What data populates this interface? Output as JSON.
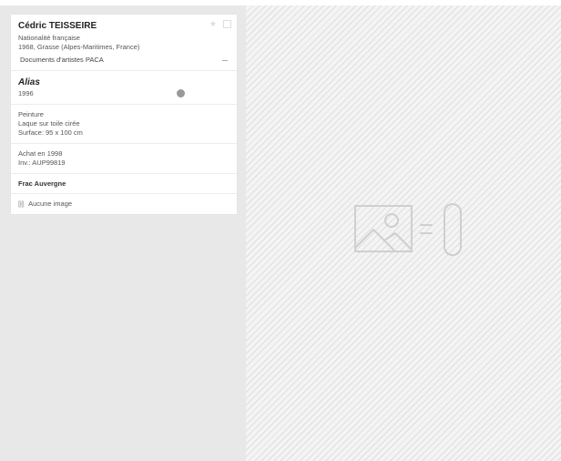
{
  "artist": {
    "name": "Cédric TEISSEIRE",
    "nationality": "Nationalité française",
    "birth": "1968, Grasse (Alpes-Maritimes, France)",
    "docs_label": "Documents d'artistes PACA"
  },
  "work": {
    "title": "Alias",
    "year": "1996"
  },
  "technique": {
    "category": "Peinture",
    "medium": "Laque sur toile cirée",
    "dimensions": "Surface: 95 x 100 cm"
  },
  "acquisition": {
    "purchase": "Achat en 1998",
    "inventory": "Inv.: AUP99819"
  },
  "owner": {
    "name": "Frac Auvergne"
  },
  "images": {
    "icon": "[]-[]",
    "label": "Aucune image"
  },
  "icons": {
    "favorite": "star-icon",
    "select": "square-icon",
    "placeholder": "image-equals-zero-icon"
  },
  "colors": {
    "left_bg": "#e8e8e8",
    "card_bg": "#ffffff",
    "stripe": "#dedede"
  }
}
